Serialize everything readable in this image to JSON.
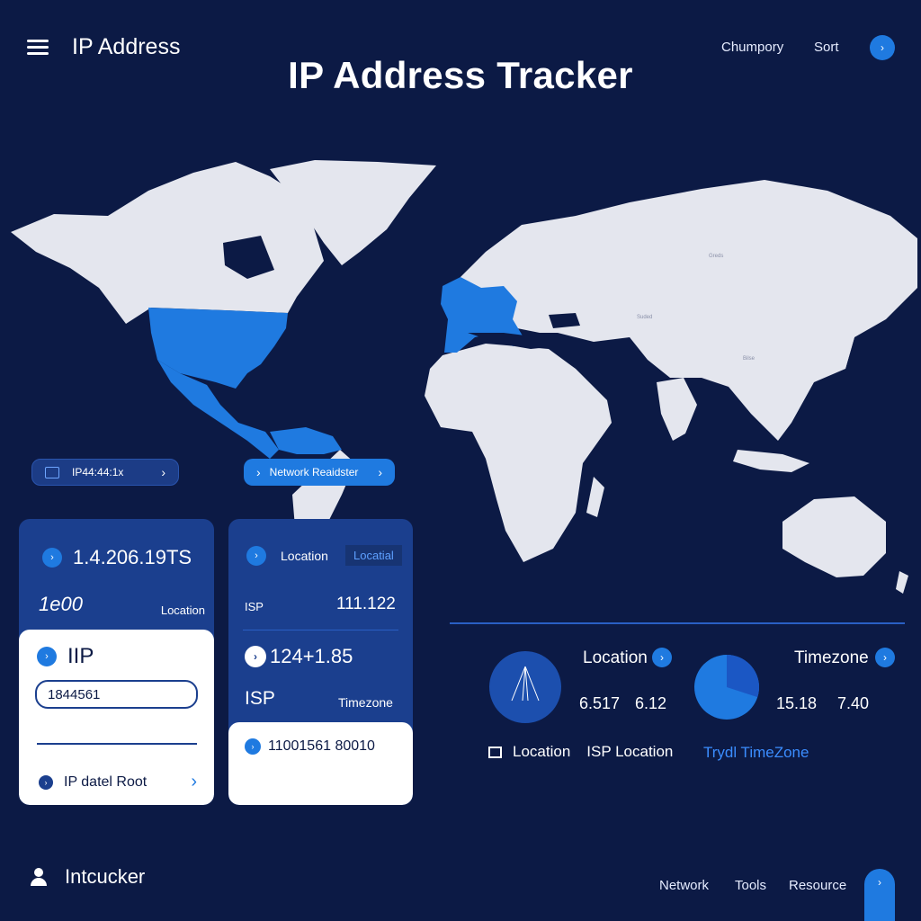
{
  "header": {
    "menu_icon": "hamburger-menu-icon",
    "app_title": "IP Address",
    "page_title": "IP Address Tracker",
    "nav": [
      "Chumpory",
      "Sort"
    ],
    "action_icon": "chevron-right-icon"
  },
  "map": {
    "highlight_color": "#1f7ae0",
    "land_color": "#e4e6ee",
    "ocean_color": "#0c1a45",
    "tags": [
      "Greds",
      "Suded",
      "Bilse"
    ]
  },
  "pills": {
    "ip_pill": "IP44:44:1x",
    "network_pill": "Network Reaidster"
  },
  "card_ip": {
    "ip_value": "1.4.206.19TS",
    "count_value": "1e00",
    "location_label": "Location",
    "section_title": "IIP",
    "input_value": "1844561",
    "link_label": "IP datel Root"
  },
  "card_location": {
    "location_label": "Location",
    "location_badge": "Locatial",
    "isp_label": "ISP",
    "isp_value": "111.122",
    "big_value": "124+1.85",
    "isp_big_label": "ISP",
    "timezone_label": "Timezone",
    "footer_value": "11001561 80010"
  },
  "stats": {
    "location_title": "Location",
    "location_values": [
      "6.517",
      "6.12"
    ],
    "timezone_title": "Timezone",
    "timezone_values": [
      "15.18",
      "7.40"
    ],
    "timezone_pie_fraction": 0.3,
    "legend": {
      "location": "Location",
      "isp_location": "ISP Location",
      "timezone_link": "Trydl TimeZone"
    }
  },
  "footer": {
    "user_label": "Intcucker",
    "links": [
      "Network",
      "Tools",
      "Resource"
    ]
  },
  "colors": {
    "accent": "#1f7ae0",
    "background": "#0c1a45",
    "card": "#1b3f8e"
  }
}
